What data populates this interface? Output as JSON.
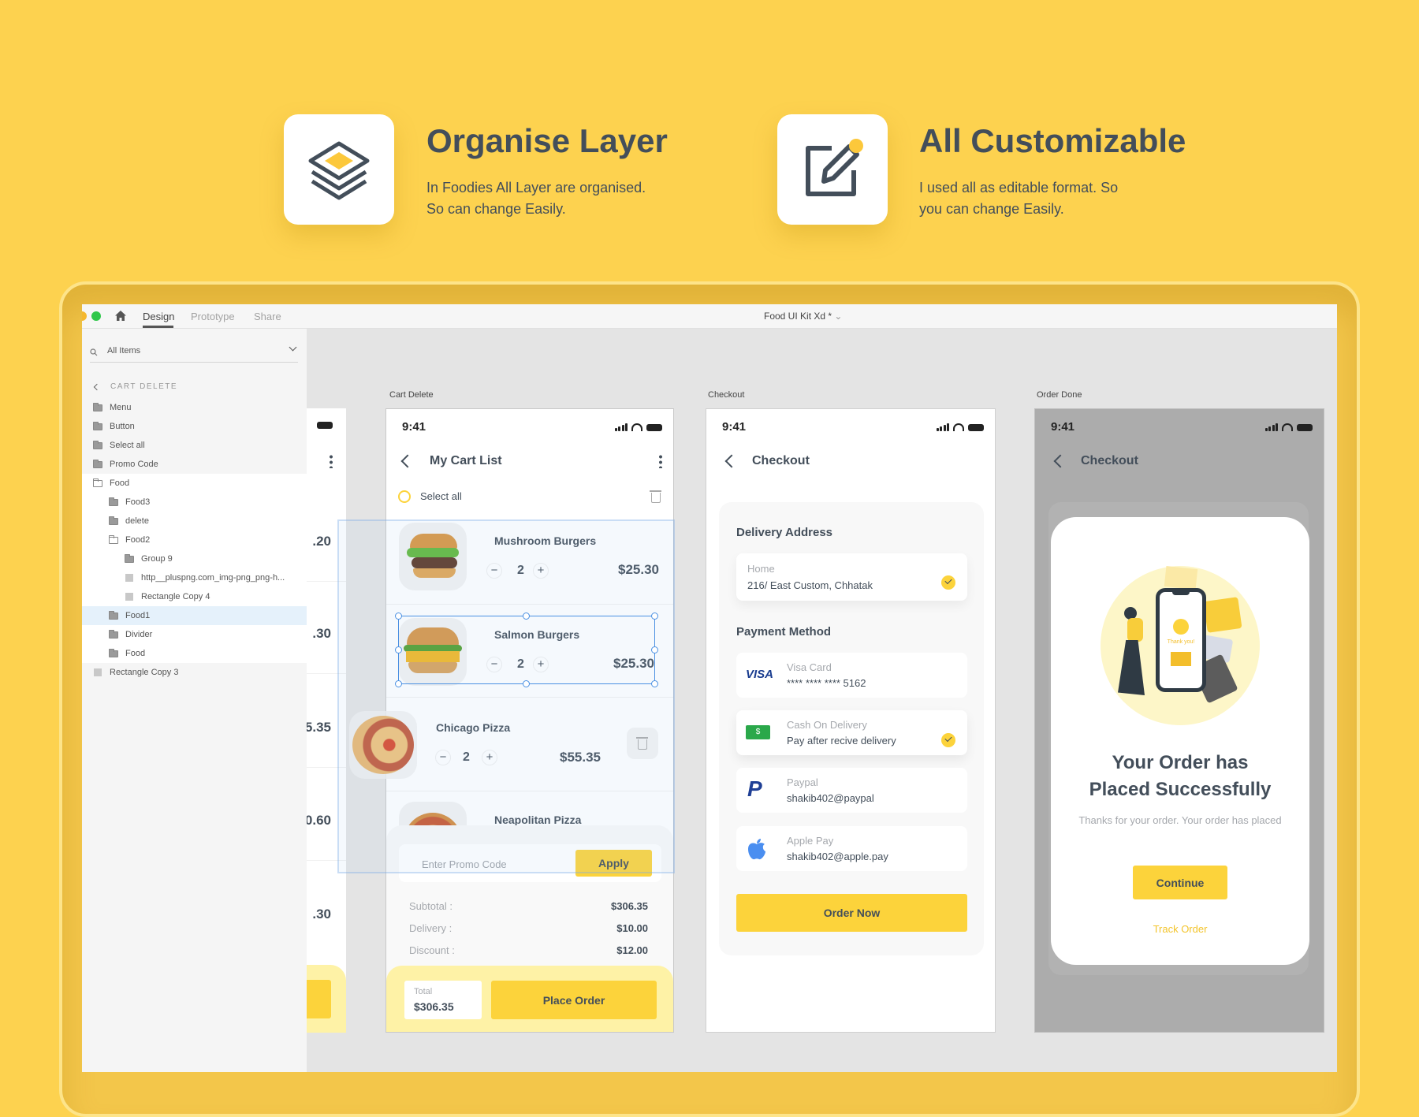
{
  "colors": {
    "background": "#fdd24f",
    "accent": "#fcd33b",
    "text": "#434e5a",
    "selection": "#4a90e2"
  },
  "features": [
    {
      "icon": "layers-icon",
      "title": "Organise Layer",
      "desc": [
        "In Foodies All Layer are organised.",
        "So can change Easily."
      ]
    },
    {
      "icon": "edit-icon",
      "title": "All Customizable",
      "desc": [
        "I used all as editable format. So",
        "you can change Easily."
      ]
    }
  ],
  "window": {
    "title": "Food UI Kit Xd *",
    "tabs": [
      "Design",
      "Prototype",
      "Share"
    ],
    "active_tab": "Design",
    "search_placeholder": "All Items",
    "layers_header": "CART DELETE",
    "layers": [
      {
        "label": "Menu",
        "type": "folder",
        "level": 0,
        "bg": "gray"
      },
      {
        "label": "Button",
        "type": "folder",
        "level": 0,
        "bg": "gray"
      },
      {
        "label": "Select all",
        "type": "folder",
        "level": 0,
        "bg": "gray"
      },
      {
        "label": "Promo Code",
        "type": "folder",
        "level": 0,
        "bg": "gray"
      },
      {
        "label": "Food",
        "type": "folder-open",
        "level": 0,
        "bg": "white"
      },
      {
        "label": "Food3",
        "type": "folder",
        "level": 1,
        "bg": "white"
      },
      {
        "label": "delete",
        "type": "folder",
        "level": 1,
        "bg": "white"
      },
      {
        "label": "Food2",
        "type": "folder-open",
        "level": 1,
        "bg": "white"
      },
      {
        "label": "Group 9",
        "type": "folder",
        "level": 2,
        "bg": "white"
      },
      {
        "label": "http__pluspng.com_img-png_png-h...",
        "type": "rect",
        "level": 2,
        "bg": "white"
      },
      {
        "label": "Rectangle Copy 4",
        "type": "rect",
        "level": 2,
        "bg": "white"
      },
      {
        "label": "Food1",
        "type": "folder",
        "level": 1,
        "bg": "selected"
      },
      {
        "label": "Divider",
        "type": "folder",
        "level": 1,
        "bg": "white"
      },
      {
        "label": "Food",
        "type": "folder",
        "level": 1,
        "bg": "white"
      },
      {
        "label": "Rectangle Copy 3",
        "type": "rect",
        "level": 0,
        "bg": "gray"
      }
    ]
  },
  "partial_artboard": {
    "prices": [
      ".20",
      ".30",
      "5.35",
      "0.60",
      ".30"
    ]
  },
  "cart": {
    "label": "Cart Delete",
    "time": "9:41",
    "title": "My Cart List",
    "select_all": "Select all",
    "items": [
      {
        "name": "Mushroom Burgers",
        "qty": "2",
        "price": "$25.30"
      },
      {
        "name": "Salmon Burgers",
        "qty": "2",
        "price": "$25.30"
      },
      {
        "name": "Chicago Pizza",
        "qty": "2",
        "price": "$55.35"
      },
      {
        "name": "Neapolitan Pizza"
      }
    ],
    "promo_placeholder": "Enter Promo Code",
    "apply": "Apply",
    "summary": [
      {
        "label": "Subtotal :",
        "value": "$306.35"
      },
      {
        "label": "Delivery :",
        "value": "$10.00"
      },
      {
        "label": "Discount :",
        "value": "$12.00"
      }
    ],
    "total_label": "Total",
    "total_value": "$306.35",
    "place_order": "Place Order"
  },
  "checkout": {
    "label": "Checkout",
    "time": "9:41",
    "title": "Checkout",
    "delivery_heading": "Delivery Address",
    "address": {
      "label": "Home",
      "value": "216/ East Custom, Chhatak"
    },
    "payment_heading": "Payment Method",
    "methods": [
      {
        "icon": "visa-icon",
        "icon_text": "VISA",
        "label": "Visa Card",
        "value": "**** **** **** 5162",
        "selected": false
      },
      {
        "icon": "cash-icon",
        "icon_text": "$",
        "label": "Cash On Delivery",
        "value": "Pay after recive delivery",
        "selected": true
      },
      {
        "icon": "paypal-icon",
        "icon_text": "P",
        "label": "Paypal",
        "value": "shakib402@paypal",
        "selected": false
      },
      {
        "icon": "apple-icon",
        "label": "Apple Pay",
        "value": "shakib402@apple.pay",
        "selected": false
      }
    ],
    "order_now": "Order Now"
  },
  "order_done": {
    "label": "Order Done",
    "time": "9:41",
    "title": "Checkout",
    "illustration_text": "Thank you!",
    "heading": [
      "Your Order has",
      "Placed Successfully"
    ],
    "subtitle": "Thanks for your order. Your order has placed",
    "continue": "Continue",
    "track": "Track Order"
  }
}
